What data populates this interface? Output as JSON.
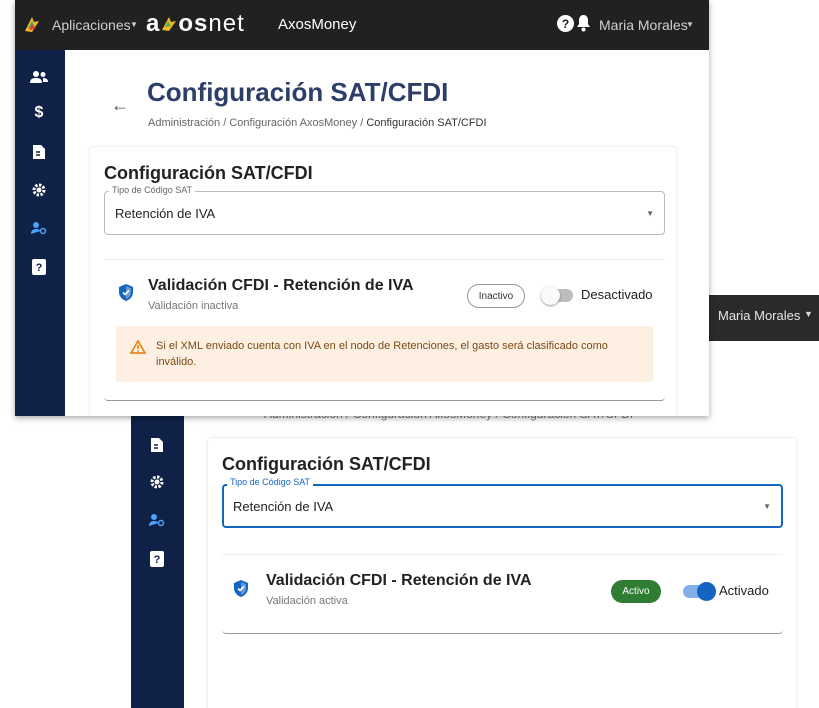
{
  "topbar": {
    "apps_label": "Aplicaciones",
    "logo_text": "axosnet",
    "app_name": "AxosMoney",
    "user_name": "Maria Morales"
  },
  "page": {
    "title": "Configuración SAT/CFDI",
    "breadcrumb": [
      "Administración",
      "/",
      "Configuración AxosMoney",
      "/",
      "Configuración SAT/CFDI"
    ]
  },
  "card": {
    "title": "Configuración SAT/CFDI",
    "field_label": "Tipo de Código SAT",
    "field_value": "Retención de IVA"
  },
  "before": {
    "validation_title": "Validación CFDI - Retención de IVA",
    "validation_sub": "Validación inactiva",
    "status_badge": "Inactivo",
    "toggle_label": "Desactivado",
    "toggle_on": false,
    "warning": "Si el XML enviado cuenta con IVA en el nodo de Retenciones, el gasto será clasificado como inválido."
  },
  "after": {
    "validation_title": "Validación CFDI - Retención de IVA",
    "validation_sub": "Validación activa",
    "status_badge": "Activo",
    "toggle_label": "Activado",
    "toggle_on": true
  },
  "partial_breadcrumb": "Administración / Configuración AxosMoney / Configuración SAT/CFDI",
  "colors": {
    "topbar": "#212121",
    "sidebar": "#0f2146",
    "title": "#2d3e6b",
    "accent_blue": "#1565c0",
    "active_green": "#2e7d32",
    "warning_bg": "#fdf0e3",
    "warning_icon": "#e07b00"
  },
  "icons": [
    "puzzle-logo-icon",
    "help-icon",
    "bell-icon",
    "users-icon",
    "dollar-icon",
    "document-icon",
    "gear-icon",
    "user-settings-icon",
    "help-square-icon",
    "back-arrow-icon",
    "shield-icon",
    "warning-icon",
    "dropdown-caret-icon"
  ]
}
